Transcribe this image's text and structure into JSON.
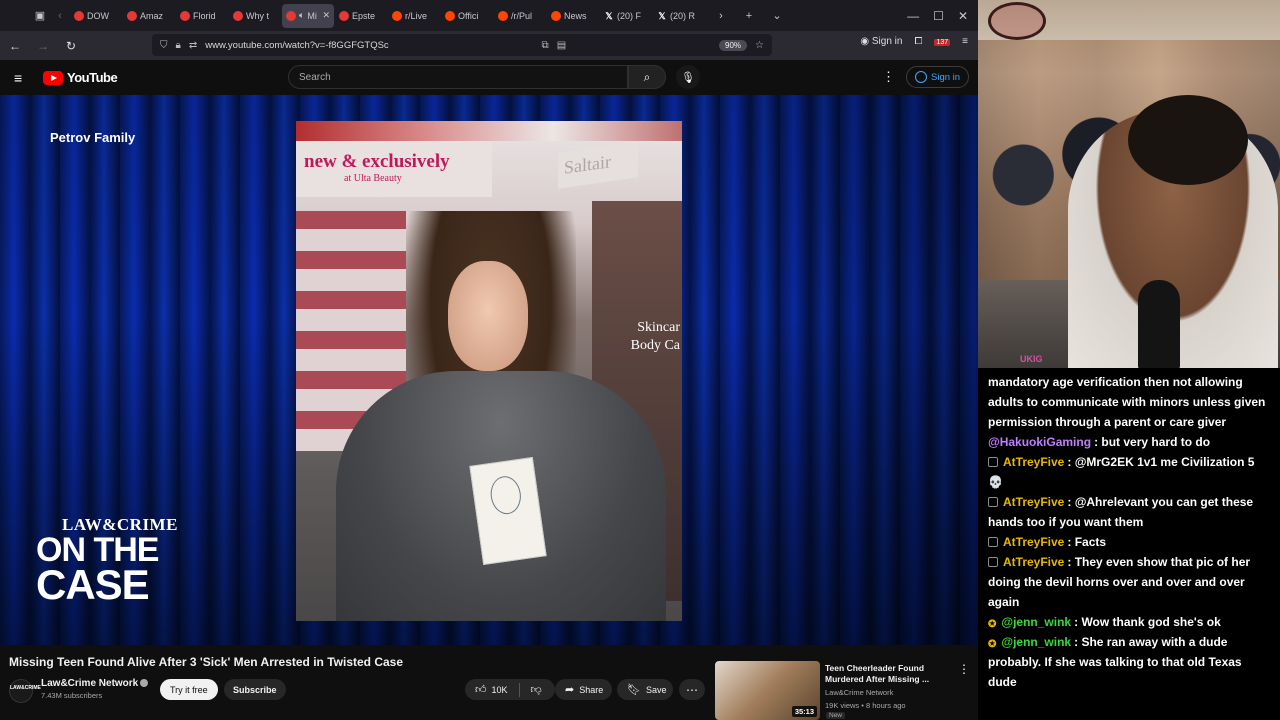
{
  "browser": {
    "tabs": [
      {
        "label": "DOW",
        "icon": "youtube-icon",
        "active": false
      },
      {
        "label": "Amaz",
        "icon": "youtube-icon",
        "active": false
      },
      {
        "label": "Florid",
        "icon": "youtube-icon",
        "active": false
      },
      {
        "label": "Why t",
        "icon": "youtube-icon",
        "active": false
      },
      {
        "label": "Mi",
        "icon": "youtube-icon",
        "active": true
      },
      {
        "label": "Epste",
        "icon": "youtube-icon",
        "active": false
      },
      {
        "label": "r/Live",
        "icon": "reddit-icon",
        "active": false
      },
      {
        "label": "Offici",
        "icon": "reddit-icon",
        "active": false
      },
      {
        "label": "/r/Pul",
        "icon": "reddit-icon",
        "active": false
      },
      {
        "label": "News",
        "icon": "reddit-icon",
        "active": false
      },
      {
        "label": "(20) F",
        "icon": "x-icon",
        "active": false
      },
      {
        "label": "(20) R",
        "icon": "x-icon",
        "active": false
      }
    ],
    "url": "www.youtube.com/watch?v=-f8GGFGTQSc",
    "zoom": "90%",
    "signin_label": "Sign in",
    "badge_count": "137"
  },
  "youtube": {
    "logo_text": "YouTube",
    "search_placeholder": "Search",
    "signin_label": "Sign in"
  },
  "video": {
    "overlay_name": "Petrov Family",
    "photo_banner_line1": "new & exclusively",
    "photo_banner_line2": "at Ulta Beauty",
    "photo_sign": "Saltair",
    "photo_poster_line1": "Skincar",
    "photo_poster_line2": "Body Ca",
    "brand_line1": "LAW&CRIME",
    "brand_line2": "ON THE",
    "brand_line3": "CASE"
  },
  "details": {
    "title": "Missing Teen Found Alive After 3 'Sick' Men Arrested in Twisted Case",
    "channel_avatar": "LAW&CRIME",
    "channel_name": "Law&Crime Network",
    "subscribers": "7.43M subscribers",
    "try_label": "Try it free",
    "subscribe_label": "Subscribe",
    "likes": "10K",
    "share_label": "Share",
    "save_label": "Save"
  },
  "recommended": {
    "title": "Teen Cheerleader Found Murdered After Missing ...",
    "channel": "Law&Crime Network",
    "meta": "19K views • 8 hours ago",
    "duration": "35:13",
    "badge": "New"
  },
  "stream": {
    "cam_tag": "UKIG"
  },
  "chat": [
    {
      "badge": "",
      "user": "",
      "user_color": "#ffffff",
      "text": "mandatory age verification then not allowing adults to communicate with minors unless given permission through a parent or care giver"
    },
    {
      "badge": "",
      "user": "@HakuokiGaming",
      "user_color": "#bf7fff",
      "text": ": but very hard to do"
    },
    {
      "badge": "mod",
      "user": "AtTreyFive",
      "user_color": "#e6b800",
      "text": ": @MrG2EK 1v1 me Civilization 5 💀"
    },
    {
      "badge": "mod",
      "user": "AtTreyFive",
      "user_color": "#e6b800",
      "text": ": @Ahrelevant you can get these hands too if you want them"
    },
    {
      "badge": "mod",
      "user": "AtTreyFive",
      "user_color": "#e6b800",
      "text": ": Facts"
    },
    {
      "badge": "mod",
      "user": "AtTreyFive",
      "user_color": "#e6b800",
      "text": ": They even show that pic of her doing the devil horns over and over and over again"
    },
    {
      "badge": "gold",
      "user": "@jenn_wink",
      "user_color": "#3ad63a",
      "text": ": Wow thank god she's ok"
    },
    {
      "badge": "gold",
      "user": "@jenn_wink",
      "user_color": "#3ad63a",
      "text": ": She ran away with a dude probably. If she was talking to that old Texas dude"
    }
  ]
}
